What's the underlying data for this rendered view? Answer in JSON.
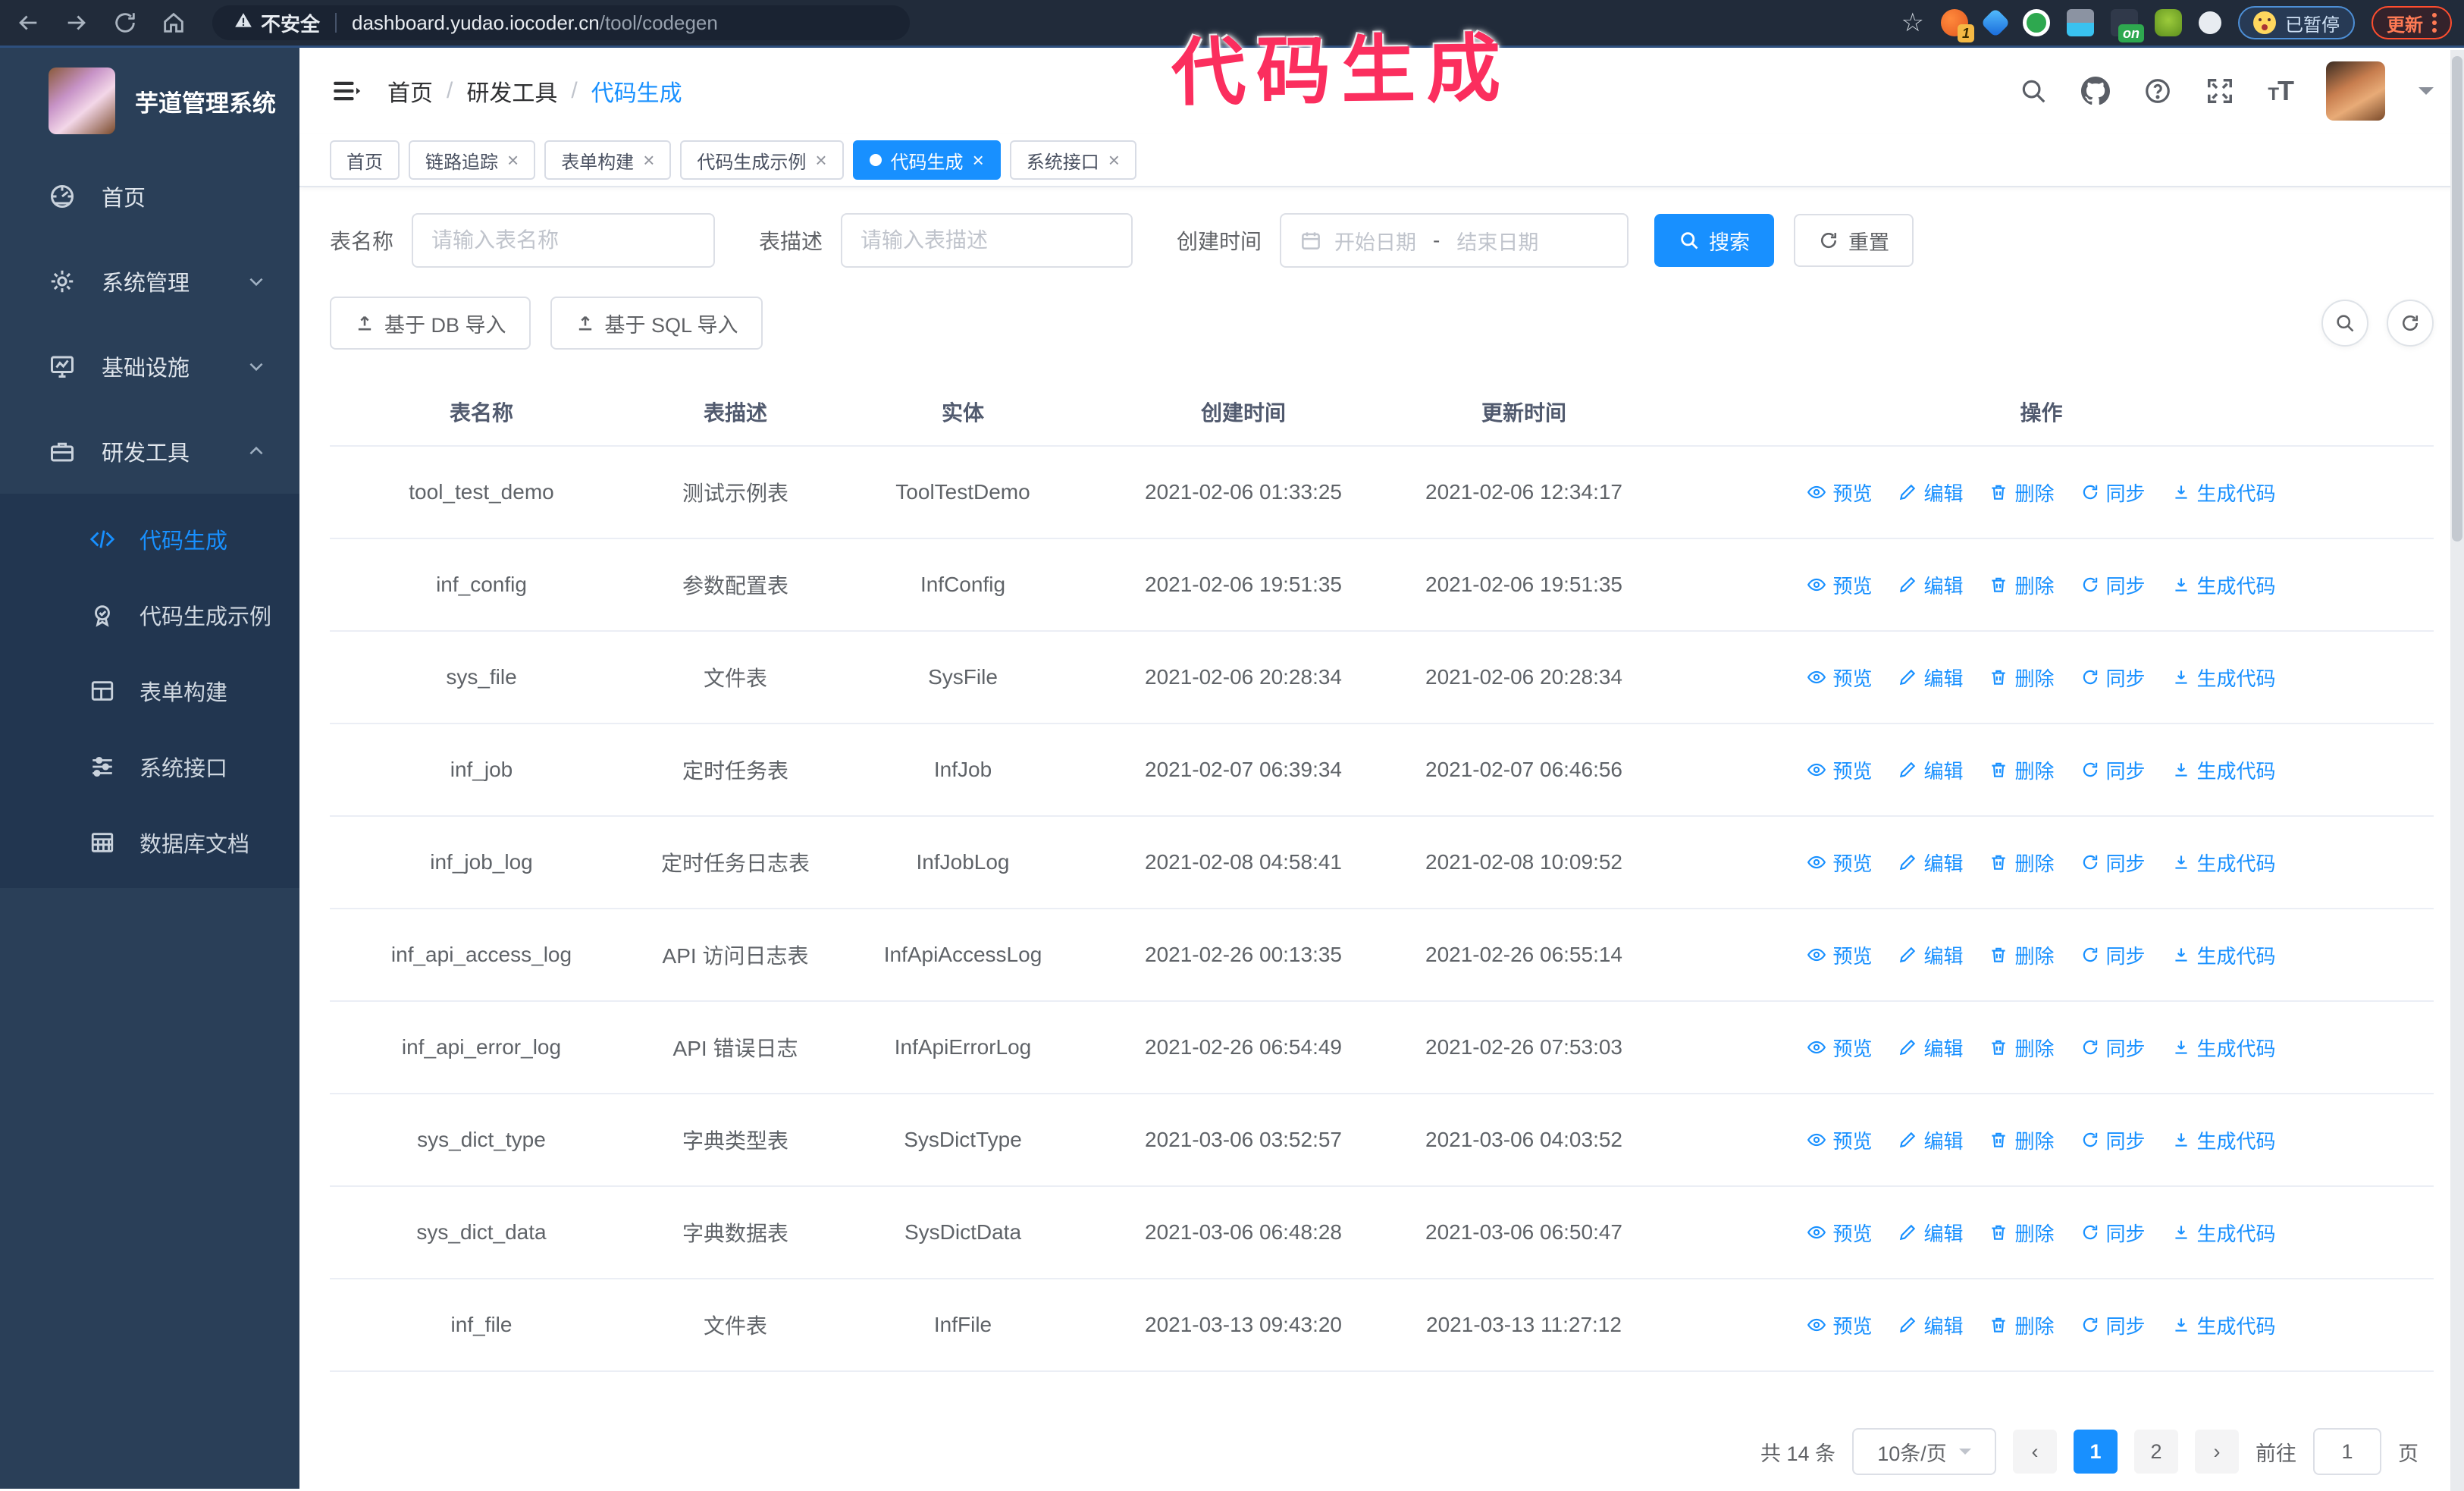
{
  "colors": {
    "accent": "#1890ff",
    "sidebar_bg": "#2a3f58",
    "annotation": "#fb2e5e"
  },
  "annotation": {
    "text": "代码生成"
  },
  "browser": {
    "security_warning": "不安全",
    "url_host": "dashboard.yudao.iocoder.cn",
    "url_path": "/tool/codegen",
    "extension_badge": "1",
    "extension_on_badge": "on",
    "paused_badge": "已暂停",
    "update_button": "更新"
  },
  "sidebar": {
    "app_title": "芋道管理系统",
    "items": [
      {
        "label": "首页"
      },
      {
        "label": "系统管理"
      },
      {
        "label": "基础设施"
      },
      {
        "label": "研发工具"
      }
    ],
    "subitems": [
      {
        "label": "代码生成",
        "active": true
      },
      {
        "label": "代码生成示例"
      },
      {
        "label": "表单构建"
      },
      {
        "label": "系统接口"
      },
      {
        "label": "数据库文档"
      }
    ]
  },
  "breadcrumb": {
    "items": [
      "首页",
      "研发工具",
      "代码生成"
    ]
  },
  "tabs": [
    {
      "label": "首页",
      "closable": false,
      "active": false
    },
    {
      "label": "链路追踪",
      "closable": true,
      "active": false
    },
    {
      "label": "表单构建",
      "closable": true,
      "active": false
    },
    {
      "label": "代码生成示例",
      "closable": true,
      "active": false
    },
    {
      "label": "代码生成",
      "closable": true,
      "active": true
    },
    {
      "label": "系统接口",
      "closable": true,
      "active": false
    }
  ],
  "search_form": {
    "table_name_label": "表名称",
    "table_name_placeholder": "请输入表名称",
    "table_desc_label": "表描述",
    "table_desc_placeholder": "请输入表描述",
    "create_time_label": "创建时间",
    "start_date_placeholder": "开始日期",
    "range_separator": "-",
    "end_date_placeholder": "结束日期",
    "search_label": "搜索",
    "reset_label": "重置"
  },
  "toolbar": {
    "import_db_label": "基于 DB 导入",
    "import_sql_label": "基于 SQL 导入"
  },
  "table": {
    "headers": [
      "表名称",
      "表描述",
      "实体",
      "创建时间",
      "更新时间",
      "操作"
    ],
    "actions": [
      "预览",
      "编辑",
      "删除",
      "同步",
      "生成代码"
    ],
    "rows": [
      [
        "tool_test_demo",
        "测试示例表",
        "ToolTestDemo",
        "2021-02-06 01:33:25",
        "2021-02-06 12:34:17"
      ],
      [
        "inf_config",
        "参数配置表",
        "InfConfig",
        "2021-02-06 19:51:35",
        "2021-02-06 19:51:35"
      ],
      [
        "sys_file",
        "文件表",
        "SysFile",
        "2021-02-06 20:28:34",
        "2021-02-06 20:28:34"
      ],
      [
        "inf_job",
        "定时任务表",
        "InfJob",
        "2021-02-07 06:39:34",
        "2021-02-07 06:46:56"
      ],
      [
        "inf_job_log",
        "定时任务日志表",
        "InfJobLog",
        "2021-02-08 04:58:41",
        "2021-02-08 10:09:52"
      ],
      [
        "inf_api_access_log",
        "API 访问日志表",
        "InfApiAccessLog",
        "2021-02-26 00:13:35",
        "2021-02-26 06:55:14"
      ],
      [
        "inf_api_error_log",
        "API 错误日志",
        "InfApiErrorLog",
        "2021-02-26 06:54:49",
        "2021-02-26 07:53:03"
      ],
      [
        "sys_dict_type",
        "字典类型表",
        "SysDictType",
        "2021-03-06 03:52:57",
        "2021-03-06 04:03:52"
      ],
      [
        "sys_dict_data",
        "字典数据表",
        "SysDictData",
        "2021-03-06 06:48:28",
        "2021-03-06 06:50:47"
      ],
      [
        "inf_file",
        "文件表",
        "InfFile",
        "2021-03-13 09:43:20",
        "2021-03-13 11:27:12"
      ]
    ]
  },
  "pagination": {
    "total_label": "共 14 条",
    "page_size": "10条/页",
    "pages": [
      {
        "label": "1",
        "active": true
      },
      {
        "label": "2",
        "active": false
      }
    ],
    "goto_label": "前往",
    "goto_value": "1",
    "page_label": "页"
  }
}
